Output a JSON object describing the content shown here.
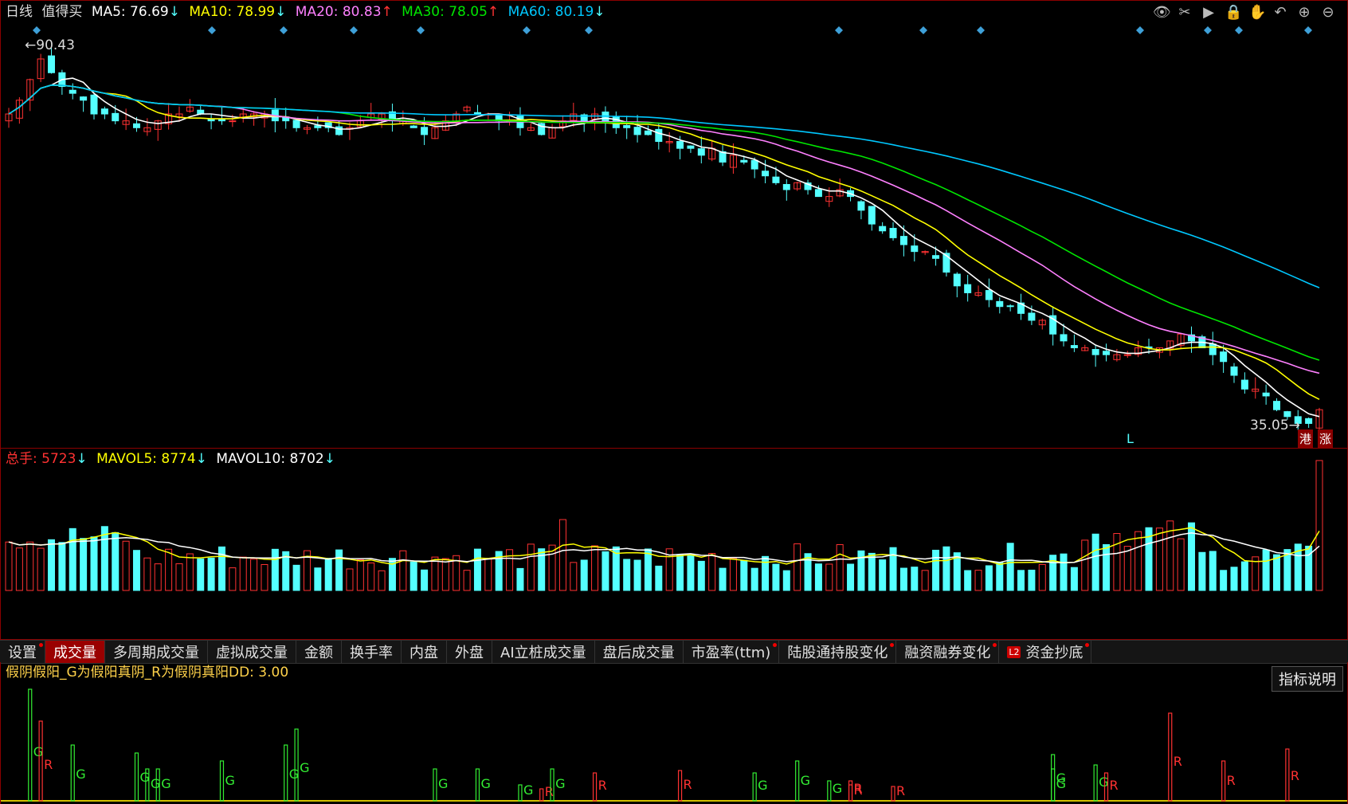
{
  "main_legend": {
    "period": "日线",
    "stock_name": "值得买",
    "ma5": "MA5: 76.69",
    "ma5_arrow": "↓",
    "ma10": "MA10: 78.99",
    "ma10_arrow": "↓",
    "ma20": "MA20: 80.83",
    "ma20_arrow": "↑",
    "ma30": "MA30: 78.05",
    "ma30_arrow": "↑",
    "ma60": "MA60: 80.19",
    "ma60_arrow": "↓"
  },
  "toolbar_icons": [
    "eye-icon",
    "scissors-icon",
    "play-icon",
    "lock-icon",
    "hand-icon",
    "undo-icon",
    "zoom-in-icon",
    "zoom-out-icon"
  ],
  "price_labels": {
    "high": "90.43",
    "low": "35.05",
    "marker_L": "L"
  },
  "badges": {
    "hk": "港",
    "limit_up": "涨"
  },
  "vol_legend": {
    "total": "总手: 5723",
    "total_arrow": "↓",
    "mavol5": "MAVOL5: 8774",
    "mavol5_arrow": "↓",
    "mavol10": "MAVOL10: 8702",
    "mavol10_arrow": "↓"
  },
  "tabs": [
    {
      "label": "设置",
      "dot": true,
      "active": false
    },
    {
      "label": "成交量",
      "dot": false,
      "active": true
    },
    {
      "label": "多周期成交量",
      "dot": false,
      "active": false
    },
    {
      "label": "虚拟成交量",
      "dot": false,
      "active": false
    },
    {
      "label": "金额",
      "dot": false,
      "active": false
    },
    {
      "label": "换手率",
      "dot": false,
      "active": false
    },
    {
      "label": "内盘",
      "dot": false,
      "active": false
    },
    {
      "label": "外盘",
      "dot": false,
      "active": false
    },
    {
      "label": "AI立桩成交量",
      "dot": false,
      "active": false
    },
    {
      "label": "盘后成交量",
      "dot": false,
      "active": false
    },
    {
      "label": "市盈率(ttm)",
      "dot": true,
      "active": false
    },
    {
      "label": "陆股通持股变化",
      "dot": true,
      "active": false
    },
    {
      "label": "融资融券变化",
      "dot": true,
      "active": false
    },
    {
      "label": "资金抄底",
      "dot": true,
      "active": false,
      "l2": "L2"
    }
  ],
  "indicator_legend": "假阴假阳_G为假阳真阴_R为假阴真阳DD: 3.00",
  "help_button": "指标说明",
  "indicator_letters": {
    "g": "G",
    "r": "R"
  },
  "colors": {
    "up": "#ff3232",
    "down": "#54ffff",
    "ma5": "#ffffff",
    "ma10": "#ffff00",
    "ma20": "#ff80ff",
    "ma30": "#00e600",
    "ma60": "#00c8ff",
    "border": "#8b0000"
  },
  "chart_data": {
    "type": "candlestick",
    "price_range": [
      35.05,
      90.43
    ],
    "close_series_approx": [
      80,
      82,
      85,
      88,
      86,
      84,
      83,
      82,
      80,
      80,
      79,
      79,
      78,
      78,
      79,
      80,
      80,
      81,
      80,
      79,
      79,
      79,
      80,
      80,
      80,
      79,
      79,
      78,
      78,
      78,
      78,
      77,
      78,
      79,
      80,
      80,
      79,
      79,
      78,
      77,
      78,
      79,
      80,
      81,
      80,
      80,
      79,
      79,
      78,
      78,
      77,
      78,
      79,
      80,
      79,
      80,
      79,
      78,
      78,
      77,
      77,
      76,
      76,
      75,
      75,
      74,
      75,
      73,
      74,
      73,
      72,
      71,
      70,
      69,
      70,
      69,
      68,
      68,
      69,
      68,
      66,
      64,
      63,
      62,
      61,
      60,
      60,
      59,
      57,
      55,
      54,
      54,
      53,
      52,
      52,
      51,
      50,
      50,
      48,
      47,
      46,
      46,
      45,
      45,
      45,
      45,
      46,
      46,
      46,
      47,
      48,
      47,
      46,
      45,
      44,
      42,
      40,
      40,
      39,
      37,
      36,
      35,
      35,
      37
    ],
    "volume_range": [
      0,
      17000
    ]
  }
}
